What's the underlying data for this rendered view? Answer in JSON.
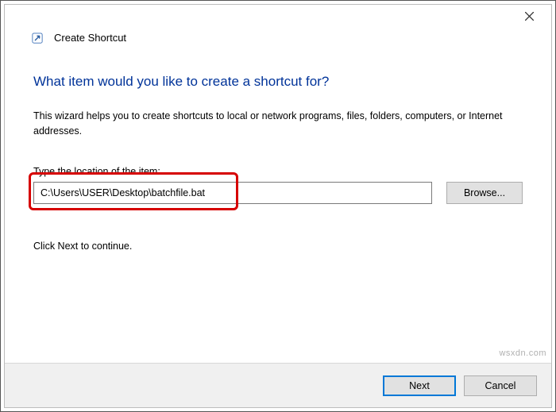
{
  "window": {
    "close_tooltip": "Close"
  },
  "header": {
    "title": "Create Shortcut"
  },
  "main": {
    "heading": "What item would you like to create a shortcut for?",
    "description": "This wizard helps you to create shortcuts to local or network programs, files, folders, computers, or Internet addresses.",
    "location_label": "Type the location of the item:",
    "location_value": "C:\\Users\\USER\\Desktop\\batchfile.bat",
    "browse_label": "Browse...",
    "continue_hint": "Click Next to continue."
  },
  "footer": {
    "next_label": "Next",
    "cancel_label": "Cancel"
  },
  "watermark": "wsxdn.com"
}
